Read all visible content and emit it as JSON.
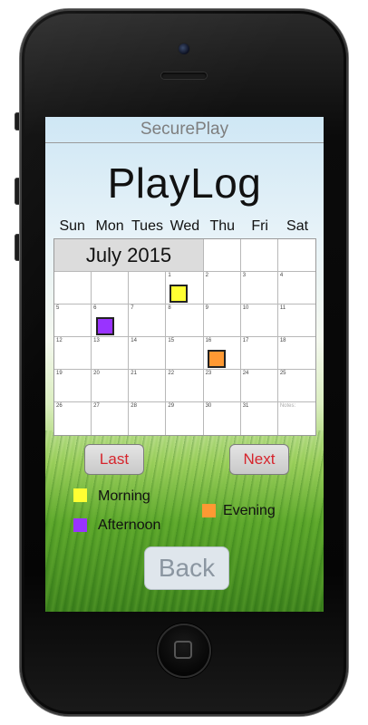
{
  "header": {
    "app_name": "SecurePlay"
  },
  "title": "PlayLog",
  "weekdays": [
    "Sun",
    "Mon",
    "Tues",
    "Wed",
    "Thu",
    "Fri",
    "Sat"
  ],
  "calendar": {
    "month": "July 2015",
    "notes_label": "Notes:",
    "dates": [
      "1",
      "2",
      "3",
      "4",
      "5",
      "6",
      "7",
      "8",
      "9",
      "10",
      "11",
      "12",
      "13",
      "14",
      "15",
      "16",
      "17",
      "18",
      "19",
      "20",
      "21",
      "22",
      "23",
      "24",
      "25",
      "26",
      "27",
      "28",
      "29",
      "30",
      "31"
    ],
    "markers": [
      {
        "date": "1",
        "period": "Morning"
      },
      {
        "date": "6",
        "period": "Afternoon"
      },
      {
        "date": "16",
        "period": "Evening"
      }
    ]
  },
  "nav": {
    "last_label": "Last",
    "next_label": "Next"
  },
  "legend": [
    {
      "label": "Morning",
      "color": "#ffff33"
    },
    {
      "label": "Afternoon",
      "color": "#9933ff"
    },
    {
      "label": "Evening",
      "color": "#ff9933"
    }
  ],
  "back_label": "Back",
  "colors": {
    "button_text": "#d6242c",
    "morning": "#ffff33",
    "afternoon": "#9933ff",
    "evening": "#ff9933"
  }
}
